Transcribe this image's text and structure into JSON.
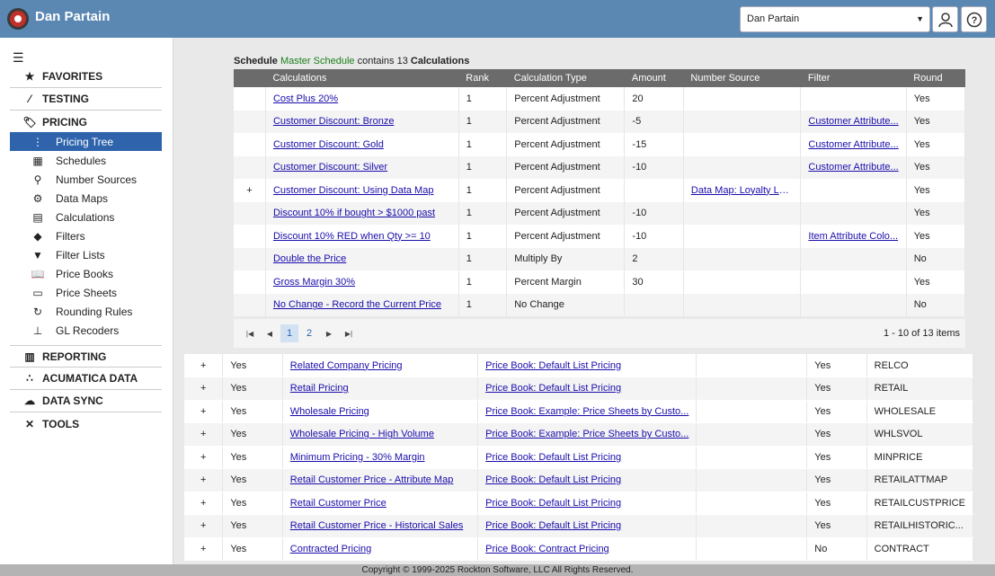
{
  "header": {
    "title": "Dan Partain",
    "user_select": "Dan Partain"
  },
  "nav": {
    "groups": [
      {
        "label": "FAVORITES"
      },
      {
        "label": "TESTING"
      },
      {
        "label": "PRICING"
      },
      {
        "label": "REPORTING"
      },
      {
        "label": "ACUMATICA DATA"
      },
      {
        "label": "DATA SYNC"
      },
      {
        "label": "TOOLS"
      }
    ],
    "items": [
      {
        "label": "Pricing Tree"
      },
      {
        "label": "Schedules"
      },
      {
        "label": "Number Sources"
      },
      {
        "label": "Data Maps"
      },
      {
        "label": "Calculations"
      },
      {
        "label": "Filters"
      },
      {
        "label": "Filter Lists"
      },
      {
        "label": "Price Books"
      },
      {
        "label": "Price Sheets"
      },
      {
        "label": "Rounding Rules"
      },
      {
        "label": "GL Recoders"
      }
    ]
  },
  "summary": {
    "schedule_word": "Schedule",
    "schedule_name": "Master Schedule",
    "contains": "contains 13",
    "calc_word": "Calculations"
  },
  "inner_table": {
    "headers": [
      "Calculations",
      "Rank",
      "Calculation Type",
      "Amount",
      "Number Source",
      "Filter",
      "Round"
    ],
    "rows": [
      {
        "exp": "",
        "name": "Cost Plus 20%",
        "rank": "1",
        "type": "Percent Adjustment",
        "amount": "20",
        "source": "",
        "filter": "",
        "round": "Yes"
      },
      {
        "exp": "",
        "name": "Customer Discount: Bronze",
        "rank": "1",
        "type": "Percent Adjustment",
        "amount": "-5",
        "source": "",
        "filter": "Customer Attribute...",
        "round": "Yes"
      },
      {
        "exp": "",
        "name": "Customer Discount: Gold",
        "rank": "1",
        "type": "Percent Adjustment",
        "amount": "-15",
        "source": "",
        "filter": "Customer Attribute...",
        "round": "Yes"
      },
      {
        "exp": "",
        "name": "Customer Discount: Silver",
        "rank": "1",
        "type": "Percent Adjustment",
        "amount": "-10",
        "source": "",
        "filter": "Customer Attribute...",
        "round": "Yes"
      },
      {
        "exp": "+",
        "name": "Customer Discount: Using Data Map",
        "rank": "1",
        "type": "Percent Adjustment",
        "amount": "",
        "source": "Data Map: Loyalty Level ...",
        "filter": "",
        "round": "Yes"
      },
      {
        "exp": "",
        "name": "Discount 10% if bought > $1000 past",
        "rank": "1",
        "type": "Percent Adjustment",
        "amount": "-10",
        "source": "",
        "filter": "",
        "round": "Yes"
      },
      {
        "exp": "",
        "name": "Discount 10% RED when Qty >= 10",
        "rank": "1",
        "type": "Percent Adjustment",
        "amount": "-10",
        "source": "",
        "filter": "Item Attribute Colo...",
        "round": "Yes"
      },
      {
        "exp": "",
        "name": "Double the Price",
        "rank": "1",
        "type": "Multiply By",
        "amount": "2",
        "source": "",
        "filter": "",
        "round": "No"
      },
      {
        "exp": "",
        "name": "Gross Margin 30%",
        "rank": "1",
        "type": "Percent Margin",
        "amount": "30",
        "source": "",
        "filter": "",
        "round": "Yes"
      },
      {
        "exp": "",
        "name": "No Change - Record the Current Price",
        "rank": "1",
        "type": "No Change",
        "amount": "",
        "source": "",
        "filter": "",
        "round": "No"
      }
    ]
  },
  "pager": {
    "pages": [
      "1",
      "2"
    ],
    "info": "1 - 10 of 13 items"
  },
  "outer_table": {
    "rows": [
      {
        "exp": "+",
        "active": "Yes",
        "name": "Related Company Pricing",
        "book": "Price Book: Default List Pricing",
        "blank": "",
        "flag": "Yes",
        "code": "RELCO"
      },
      {
        "exp": "+",
        "active": "Yes",
        "name": "Retail Pricing",
        "book": "Price Book: Default List Pricing",
        "blank": "",
        "flag": "Yes",
        "code": "RETAIL"
      },
      {
        "exp": "+",
        "active": "Yes",
        "name": "Wholesale Pricing",
        "book": "Price Book: Example: Price Sheets by Custo...",
        "blank": "",
        "flag": "Yes",
        "code": "WHOLESALE"
      },
      {
        "exp": "+",
        "active": "Yes",
        "name": "Wholesale Pricing - High Volume",
        "book": "Price Book: Example: Price Sheets by Custo...",
        "blank": "",
        "flag": "Yes",
        "code": "WHLSVOL"
      },
      {
        "exp": "+",
        "active": "Yes",
        "name": "Minimum Pricing - 30% Margin",
        "book": "Price Book: Default List Pricing",
        "blank": "",
        "flag": "Yes",
        "code": "MINPRICE"
      },
      {
        "exp": "+",
        "active": "Yes",
        "name": "Retail Customer Price - Attribute Map",
        "book": "Price Book: Default List Pricing",
        "blank": "",
        "flag": "Yes",
        "code": "RETAILATTMAP"
      },
      {
        "exp": "+",
        "active": "Yes",
        "name": "Retail Customer Price",
        "book": "Price Book: Default List Pricing",
        "blank": "",
        "flag": "Yes",
        "code": "RETAILCUSTPRICE"
      },
      {
        "exp": "+",
        "active": "Yes",
        "name": "Retail Customer Price - Historical Sales",
        "book": "Price Book: Default List Pricing",
        "blank": "",
        "flag": "Yes",
        "code": "RETAILHISTORIC..."
      },
      {
        "exp": "+",
        "active": "Yes",
        "name": "Contracted Pricing",
        "book": "Price Book: Contract Pricing",
        "blank": "",
        "flag": "No",
        "code": "CONTRACT"
      }
    ]
  },
  "footer": "Copyright © 1999-2025 Rockton Software, LLC All Rights Reserved."
}
